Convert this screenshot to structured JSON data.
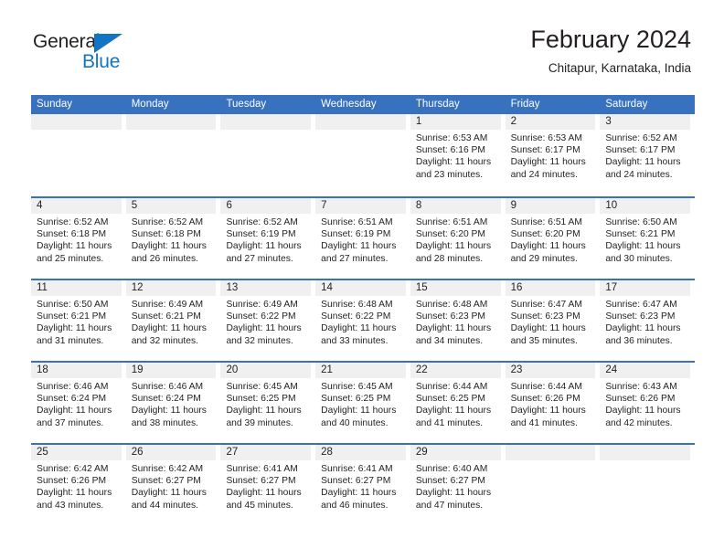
{
  "brand": {
    "name_top": "General",
    "name_bottom": "Blue",
    "accent_color": "#1275c4"
  },
  "header": {
    "title": "February 2024",
    "location": "Chitapur, Karnataka, India"
  },
  "calendar": {
    "header_bg_color": "#3871bd",
    "day_band_color": "#f0f0f0",
    "weekdays": [
      "Sunday",
      "Monday",
      "Tuesday",
      "Wednesday",
      "Thursday",
      "Friday",
      "Saturday"
    ],
    "weeks": [
      [
        {
          "date": "",
          "empty": true
        },
        {
          "date": "",
          "empty": true
        },
        {
          "date": "",
          "empty": true
        },
        {
          "date": "",
          "empty": true
        },
        {
          "date": "1",
          "sunrise": "Sunrise: 6:53 AM",
          "sunset": "Sunset: 6:16 PM",
          "daylight_line1": "Daylight: 11 hours",
          "daylight_line2": "and 23 minutes."
        },
        {
          "date": "2",
          "sunrise": "Sunrise: 6:53 AM",
          "sunset": "Sunset: 6:17 PM",
          "daylight_line1": "Daylight: 11 hours",
          "daylight_line2": "and 24 minutes."
        },
        {
          "date": "3",
          "sunrise": "Sunrise: 6:52 AM",
          "sunset": "Sunset: 6:17 PM",
          "daylight_line1": "Daylight: 11 hours",
          "daylight_line2": "and 24 minutes."
        }
      ],
      [
        {
          "date": "4",
          "sunrise": "Sunrise: 6:52 AM",
          "sunset": "Sunset: 6:18 PM",
          "daylight_line1": "Daylight: 11 hours",
          "daylight_line2": "and 25 minutes."
        },
        {
          "date": "5",
          "sunrise": "Sunrise: 6:52 AM",
          "sunset": "Sunset: 6:18 PM",
          "daylight_line1": "Daylight: 11 hours",
          "daylight_line2": "and 26 minutes."
        },
        {
          "date": "6",
          "sunrise": "Sunrise: 6:52 AM",
          "sunset": "Sunset: 6:19 PM",
          "daylight_line1": "Daylight: 11 hours",
          "daylight_line2": "and 27 minutes."
        },
        {
          "date": "7",
          "sunrise": "Sunrise: 6:51 AM",
          "sunset": "Sunset: 6:19 PM",
          "daylight_line1": "Daylight: 11 hours",
          "daylight_line2": "and 27 minutes."
        },
        {
          "date": "8",
          "sunrise": "Sunrise: 6:51 AM",
          "sunset": "Sunset: 6:20 PM",
          "daylight_line1": "Daylight: 11 hours",
          "daylight_line2": "and 28 minutes."
        },
        {
          "date": "9",
          "sunrise": "Sunrise: 6:51 AM",
          "sunset": "Sunset: 6:20 PM",
          "daylight_line1": "Daylight: 11 hours",
          "daylight_line2": "and 29 minutes."
        },
        {
          "date": "10",
          "sunrise": "Sunrise: 6:50 AM",
          "sunset": "Sunset: 6:21 PM",
          "daylight_line1": "Daylight: 11 hours",
          "daylight_line2": "and 30 minutes."
        }
      ],
      [
        {
          "date": "11",
          "sunrise": "Sunrise: 6:50 AM",
          "sunset": "Sunset: 6:21 PM",
          "daylight_line1": "Daylight: 11 hours",
          "daylight_line2": "and 31 minutes."
        },
        {
          "date": "12",
          "sunrise": "Sunrise: 6:49 AM",
          "sunset": "Sunset: 6:21 PM",
          "daylight_line1": "Daylight: 11 hours",
          "daylight_line2": "and 32 minutes."
        },
        {
          "date": "13",
          "sunrise": "Sunrise: 6:49 AM",
          "sunset": "Sunset: 6:22 PM",
          "daylight_line1": "Daylight: 11 hours",
          "daylight_line2": "and 32 minutes."
        },
        {
          "date": "14",
          "sunrise": "Sunrise: 6:48 AM",
          "sunset": "Sunset: 6:22 PM",
          "daylight_line1": "Daylight: 11 hours",
          "daylight_line2": "and 33 minutes."
        },
        {
          "date": "15",
          "sunrise": "Sunrise: 6:48 AM",
          "sunset": "Sunset: 6:23 PM",
          "daylight_line1": "Daylight: 11 hours",
          "daylight_line2": "and 34 minutes."
        },
        {
          "date": "16",
          "sunrise": "Sunrise: 6:47 AM",
          "sunset": "Sunset: 6:23 PM",
          "daylight_line1": "Daylight: 11 hours",
          "daylight_line2": "and 35 minutes."
        },
        {
          "date": "17",
          "sunrise": "Sunrise: 6:47 AM",
          "sunset": "Sunset: 6:23 PM",
          "daylight_line1": "Daylight: 11 hours",
          "daylight_line2": "and 36 minutes."
        }
      ],
      [
        {
          "date": "18",
          "sunrise": "Sunrise: 6:46 AM",
          "sunset": "Sunset: 6:24 PM",
          "daylight_line1": "Daylight: 11 hours",
          "daylight_line2": "and 37 minutes."
        },
        {
          "date": "19",
          "sunrise": "Sunrise: 6:46 AM",
          "sunset": "Sunset: 6:24 PM",
          "daylight_line1": "Daylight: 11 hours",
          "daylight_line2": "and 38 minutes."
        },
        {
          "date": "20",
          "sunrise": "Sunrise: 6:45 AM",
          "sunset": "Sunset: 6:25 PM",
          "daylight_line1": "Daylight: 11 hours",
          "daylight_line2": "and 39 minutes."
        },
        {
          "date": "21",
          "sunrise": "Sunrise: 6:45 AM",
          "sunset": "Sunset: 6:25 PM",
          "daylight_line1": "Daylight: 11 hours",
          "daylight_line2": "and 40 minutes."
        },
        {
          "date": "22",
          "sunrise": "Sunrise: 6:44 AM",
          "sunset": "Sunset: 6:25 PM",
          "daylight_line1": "Daylight: 11 hours",
          "daylight_line2": "and 41 minutes."
        },
        {
          "date": "23",
          "sunrise": "Sunrise: 6:44 AM",
          "sunset": "Sunset: 6:26 PM",
          "daylight_line1": "Daylight: 11 hours",
          "daylight_line2": "and 41 minutes."
        },
        {
          "date": "24",
          "sunrise": "Sunrise: 6:43 AM",
          "sunset": "Sunset: 6:26 PM",
          "daylight_line1": "Daylight: 11 hours",
          "daylight_line2": "and 42 minutes."
        }
      ],
      [
        {
          "date": "25",
          "sunrise": "Sunrise: 6:42 AM",
          "sunset": "Sunset: 6:26 PM",
          "daylight_line1": "Daylight: 11 hours",
          "daylight_line2": "and 43 minutes."
        },
        {
          "date": "26",
          "sunrise": "Sunrise: 6:42 AM",
          "sunset": "Sunset: 6:27 PM",
          "daylight_line1": "Daylight: 11 hours",
          "daylight_line2": "and 44 minutes."
        },
        {
          "date": "27",
          "sunrise": "Sunrise: 6:41 AM",
          "sunset": "Sunset: 6:27 PM",
          "daylight_line1": "Daylight: 11 hours",
          "daylight_line2": "and 45 minutes."
        },
        {
          "date": "28",
          "sunrise": "Sunrise: 6:41 AM",
          "sunset": "Sunset: 6:27 PM",
          "daylight_line1": "Daylight: 11 hours",
          "daylight_line2": "and 46 minutes."
        },
        {
          "date": "29",
          "sunrise": "Sunrise: 6:40 AM",
          "sunset": "Sunset: 6:27 PM",
          "daylight_line1": "Daylight: 11 hours",
          "daylight_line2": "and 47 minutes."
        },
        {
          "date": "",
          "empty": true
        },
        {
          "date": "",
          "empty": true
        }
      ]
    ]
  }
}
